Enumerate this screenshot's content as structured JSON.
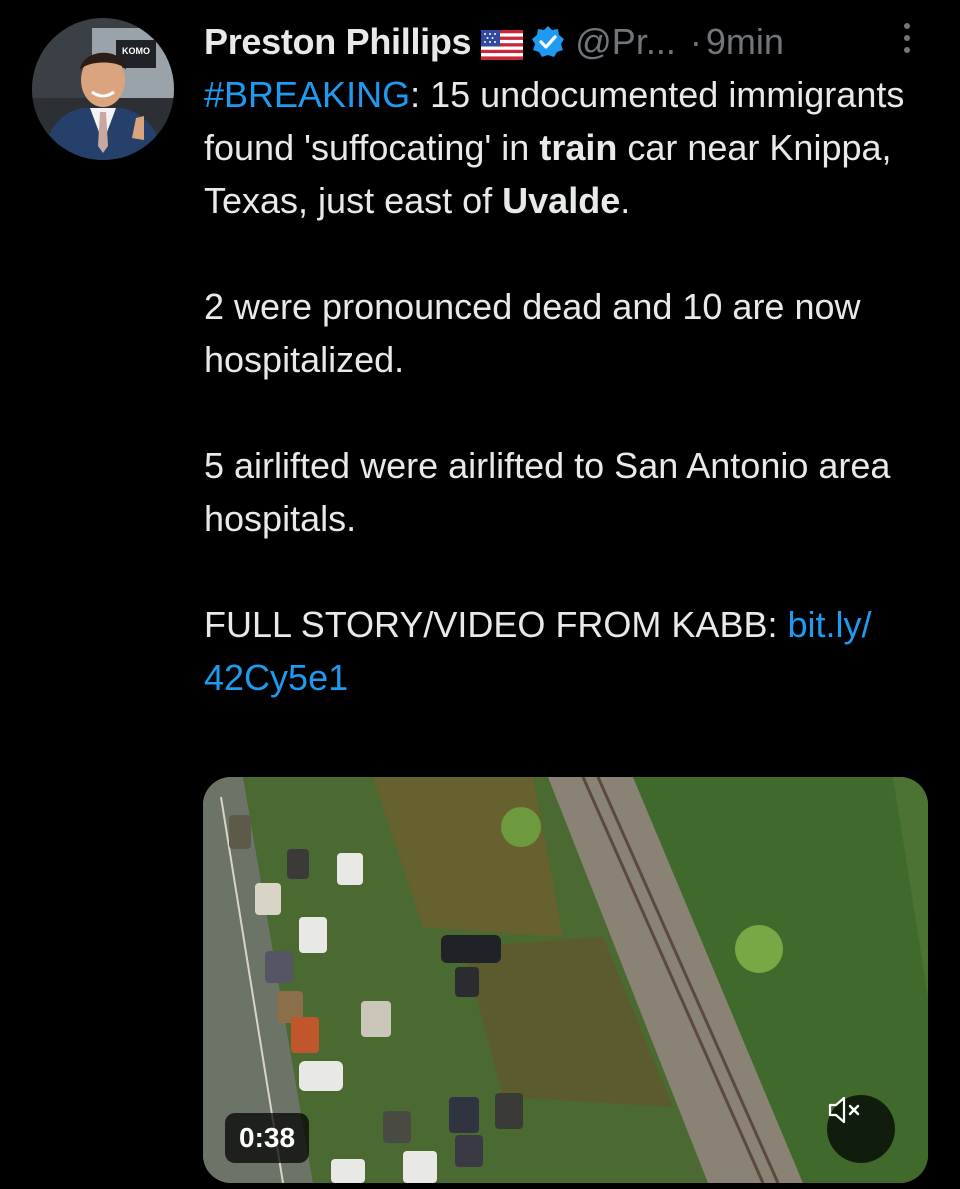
{
  "author": {
    "name": "Preston Phillips",
    "handle": "@Pr...",
    "separator": "·",
    "time": "9min",
    "avatar_logo_text": "KOMO"
  },
  "tweet": {
    "line1": {
      "hashtag": "#BREAKING",
      "text_a": ":  15 undocumented immigrants found 'suffocating' in ",
      "bold1": "train",
      "text_b": " car near Knippa, Texas, just east of ",
      "bold2": "Uvalde",
      "text_c": "."
    },
    "paragraph2": "2 were pronounced dead and 10 are now hospitalized.",
    "paragraph3": "5 airlifted were airlifted to San Antonio area hospitals.",
    "paragraph4": {
      "text": "FULL STORY/VIDEO FROM KABB: ",
      "link": "bit.ly/ 42Cy5e1"
    }
  },
  "media": {
    "duration": "0:38",
    "muted": true
  },
  "colors": {
    "background": "#000000",
    "text": "#e7e9ea",
    "muted": "#71767b",
    "link": "#1d9bf0",
    "verified": "#1d9bf0"
  }
}
